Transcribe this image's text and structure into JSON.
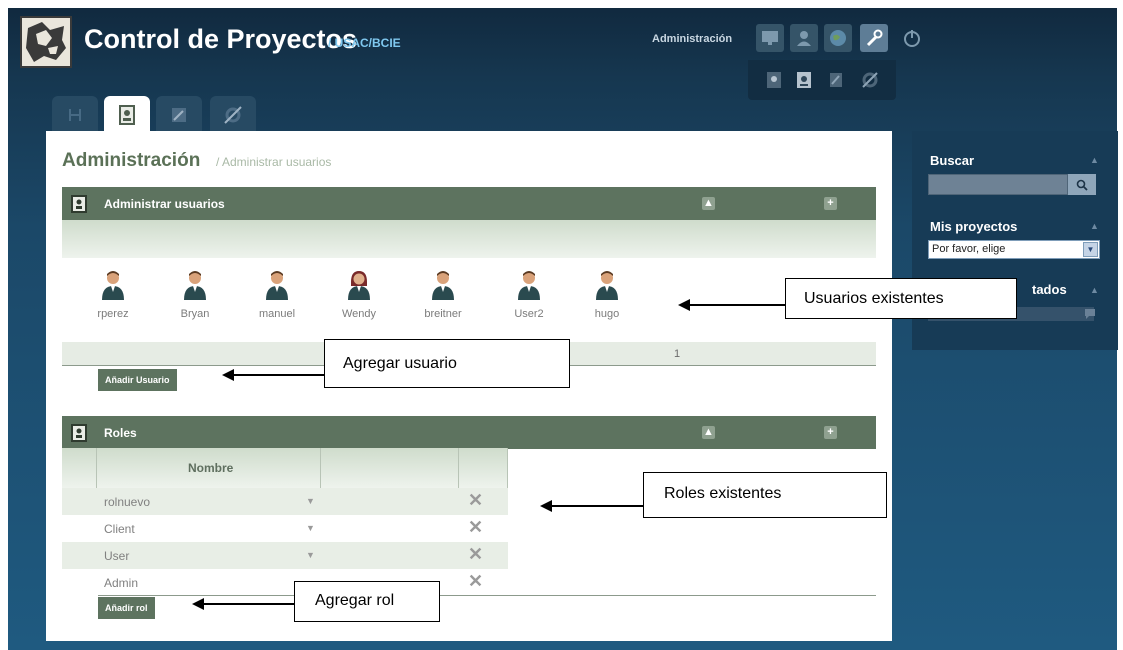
{
  "header": {
    "app_title": "Control de Proyectos",
    "app_subtitle": "/ USAC/BCIE",
    "admin_link": "Administración"
  },
  "page": {
    "title": "Administración",
    "breadcrumb": "/ Administrar usuarios"
  },
  "users_panel": {
    "title": "Administrar usuarios",
    "users": [
      "rperez",
      "Bryan",
      "manuel",
      "Wendy",
      "breitner",
      "User2",
      "hugo"
    ],
    "page_number": "1",
    "add_button": "Añadir Usuario"
  },
  "roles_panel": {
    "title": "Roles",
    "column_name": "Nombre",
    "roles": [
      "rolnuevo",
      "Client",
      "User",
      "Admin"
    ],
    "add_button": "Añadir rol"
  },
  "sidebar": {
    "search_label": "Buscar",
    "projects_label": "Mis proyectos",
    "projects_select": "Por favor, elige",
    "third_label": "tados"
  },
  "annotations": {
    "users_existing": "Usuarios existentes",
    "add_user": "Agregar usuario",
    "roles_existing": "Roles  existentes",
    "add_role": "Agregar rol"
  },
  "colors": {
    "panel_header": "#5d735f",
    "title_green": "#5b7157",
    "sub_accent": "#7fc8ef",
    "sidebar_bg": "#173b56"
  }
}
